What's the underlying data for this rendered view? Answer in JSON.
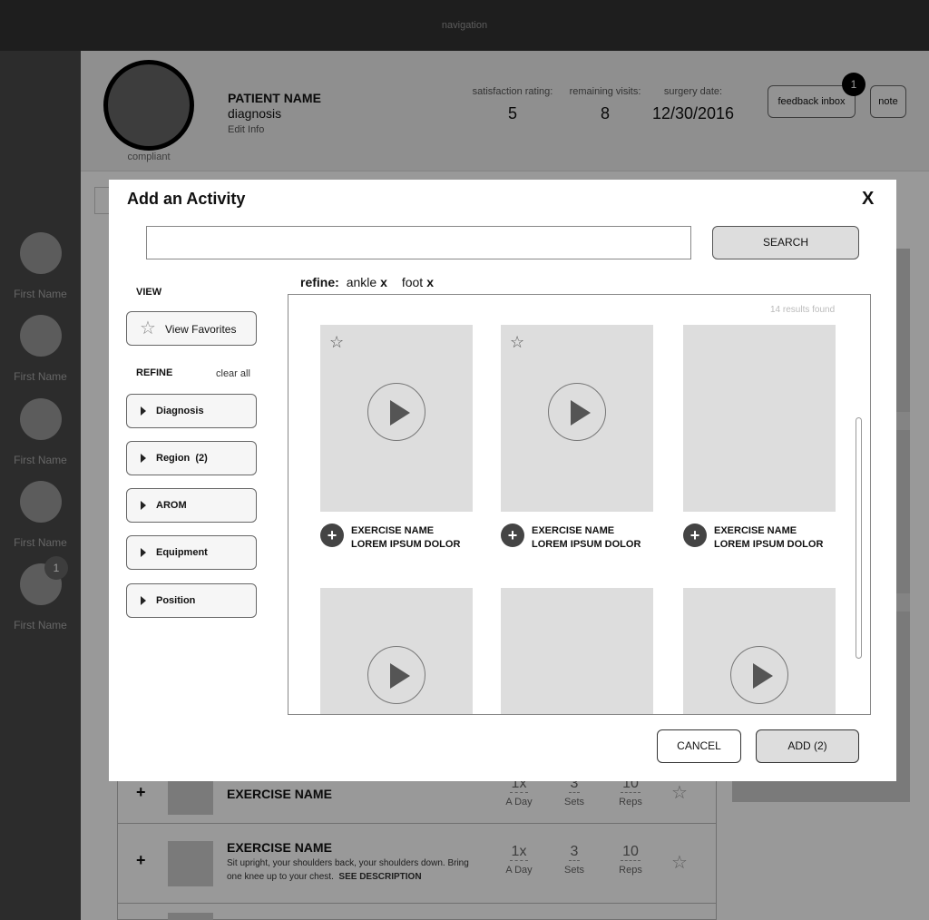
{
  "nav": {
    "label": "navigation"
  },
  "contacts": [
    {
      "name": "First Name",
      "badge": ""
    },
    {
      "name": "First Name",
      "badge": ""
    },
    {
      "name": "First Name",
      "badge": ""
    },
    {
      "name": "First Name",
      "badge": ""
    },
    {
      "name": "First Name",
      "badge": "1"
    }
  ],
  "patient": {
    "status": "compliant",
    "name": "PATIENT NAME",
    "diagnosis": "diagnosis",
    "edit_label": "Edit Info",
    "stats": [
      {
        "label": "satisfaction rating:",
        "value": "5"
      },
      {
        "label": "remaining visits:",
        "value": "8"
      },
      {
        "label": "surgery date:",
        "value": "12/30/2016"
      }
    ],
    "feedback_label": "feedback inbox",
    "feedback_count": "1",
    "note_label": "note"
  },
  "background_list": [
    {
      "name": "EXERCISE NAME",
      "desc": "",
      "see": "",
      "metrics": [
        {
          "n": "1x",
          "u": "A Day"
        },
        {
          "n": "3",
          "u": "Sets"
        },
        {
          "n": "10",
          "u": "Reps"
        }
      ]
    },
    {
      "name": "EXERCISE NAME",
      "desc": "Sit upright, your shoulders back, your shoulders down. Bring one knee up to your chest.",
      "see": "SEE DESCRIPTION",
      "metrics": [
        {
          "n": "1x",
          "u": "A Day"
        },
        {
          "n": "3",
          "u": "Sets"
        },
        {
          "n": "10",
          "u": "Reps"
        }
      ]
    }
  ],
  "modal": {
    "title": "Add an Activity",
    "close": "X",
    "search": {
      "value": "",
      "placeholder": "",
      "button": "SEARCH"
    },
    "view_label": "VIEW",
    "favorites_label": "View Favorites",
    "refine_label": "REFINE",
    "clear_all": "clear all",
    "facets": [
      "Diagnosis",
      "Region  (2)",
      "AROM",
      "Equipment",
      "Position"
    ],
    "refine_bar": {
      "label": "refine:",
      "tags": [
        {
          "text": "ankle",
          "remove": "x"
        },
        {
          "text": "foot",
          "remove": "x"
        }
      ]
    },
    "results_count": "14 results found",
    "cards": [
      {
        "line1": "EXERCISE NAME",
        "line2": "LOREM IPSUM DOLOR",
        "favorite": true,
        "play": true,
        "add": "+"
      },
      {
        "line1": "EXERCISE NAME",
        "line2": "LOREM IPSUM DOLOR",
        "favorite": true,
        "play": true,
        "add": "+"
      },
      {
        "line1": "EXERCISE NAME",
        "line2": "LOREM IPSUM DOLOR",
        "favorite": false,
        "play": false,
        "add": "+"
      },
      {
        "line1": "",
        "line2": "",
        "favorite": false,
        "play": true,
        "add": ""
      },
      {
        "line1": "",
        "line2": "",
        "favorite": false,
        "play": false,
        "add": ""
      },
      {
        "line1": "",
        "line2": "",
        "favorite": false,
        "play": true,
        "add": ""
      }
    ],
    "cancel_label": "CANCEL",
    "add_label": "ADD (2)"
  },
  "icons": {
    "star": "star-icon",
    "play": "play-icon",
    "plus": "plus-icon",
    "caret": "caret-right-icon"
  },
  "colors": {
    "overlay": "#000000",
    "card_bg": "#dddddd",
    "button_bg": "#dddddd"
  }
}
